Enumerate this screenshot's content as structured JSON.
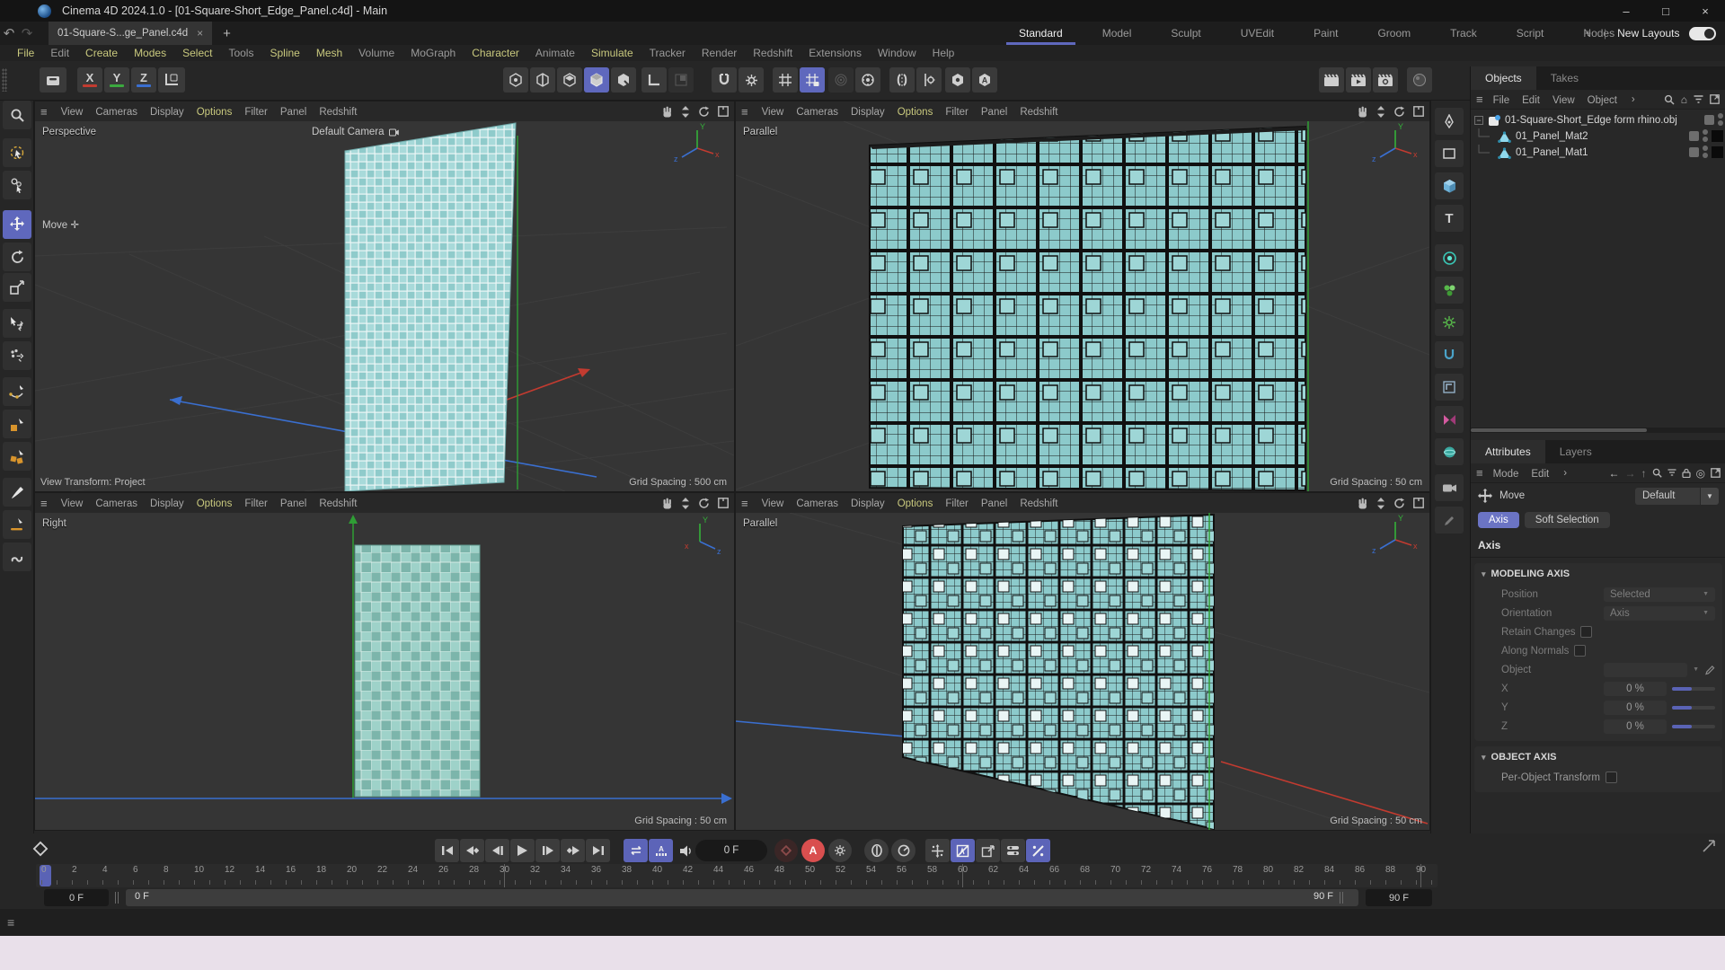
{
  "icons": {
    "hamburger": "≡",
    "close": "×",
    "plus": "+",
    "dropdown": "▼",
    "small_arrow": "▼",
    "collapse": "▾",
    "chevron": "›",
    "undo": "↶",
    "redo": "↷",
    "back": "←",
    "forward": "→",
    "up": "↑",
    "home": "⌂",
    "target": "◎",
    "minimize": "–",
    "maximize": "□",
    "expand_minus": "−",
    "move_cross": "✛"
  },
  "window": {
    "title": "Cinema 4D 2024.1.0 - [01-Square-Short_Edge_Panel.c4d] - Main"
  },
  "tab_bar": {
    "document_tab": "01-Square-S...ge_Panel.c4d"
  },
  "layout_tabs": {
    "items": [
      {
        "label": "Standard",
        "cls": "active"
      },
      {
        "label": "Model"
      },
      {
        "label": "Sculpt"
      },
      {
        "label": "UVEdit"
      },
      {
        "label": "Paint"
      },
      {
        "label": "Groom"
      },
      {
        "label": "Track"
      },
      {
        "label": "Script"
      },
      {
        "label": "Nodes"
      }
    ],
    "add": "+",
    "new_layouts_label": "New Layouts"
  },
  "menu_bar": {
    "items": [
      {
        "label": "File",
        "cls": "hl"
      },
      {
        "label": "Edit"
      },
      {
        "label": "Create",
        "cls": "hl"
      },
      {
        "label": "Modes",
        "cls": "hl"
      },
      {
        "label": "Select",
        "cls": "hl"
      },
      {
        "label": "Tools"
      },
      {
        "label": "Spline",
        "cls": "hl"
      },
      {
        "label": "Mesh",
        "cls": "hl"
      },
      {
        "label": "Volume"
      },
      {
        "label": "MoGraph"
      },
      {
        "label": "Character",
        "cls": "hl"
      },
      {
        "label": "Animate"
      },
      {
        "label": "Simulate",
        "cls": "hl"
      },
      {
        "label": "Tracker"
      },
      {
        "label": "Render"
      },
      {
        "label": "Redshift"
      },
      {
        "label": "Extensions"
      },
      {
        "label": "Window"
      },
      {
        "label": "Help"
      }
    ]
  },
  "toolbar": {
    "x": "X",
    "y": "Y",
    "z": "Z"
  },
  "viewports": [
    {
      "name": "Perspective",
      "camera_label": "Default Camera",
      "tool_label": "Move",
      "view_transform": "View Transform: Project",
      "grid_spacing": "Grid Spacing : 500 cm",
      "menu": [
        {
          "label": "View"
        },
        {
          "label": "Cameras"
        },
        {
          "label": "Display"
        },
        {
          "label": "Options",
          "cls": "hl"
        },
        {
          "label": "Filter"
        },
        {
          "label": "Panel"
        },
        {
          "label": "Redshift"
        }
      ]
    },
    {
      "name": "Parallel",
      "grid_spacing": "Grid Spacing : 50 cm",
      "menu": [
        {
          "label": "View"
        },
        {
          "label": "Cameras"
        },
        {
          "label": "Display"
        },
        {
          "label": "Options",
          "cls": "hl"
        },
        {
          "label": "Filter"
        },
        {
          "label": "Panel"
        },
        {
          "label": "Redshift"
        }
      ]
    },
    {
      "name": "Right",
      "grid_spacing": "Grid Spacing : 50 cm",
      "menu": [
        {
          "label": "View"
        },
        {
          "label": "Cameras"
        },
        {
          "label": "Display"
        },
        {
          "label": "Options",
          "cls": "hl"
        },
        {
          "label": "Filter"
        },
        {
          "label": "Panel"
        },
        {
          "label": "Redshift"
        }
      ]
    },
    {
      "name": "Parallel",
      "grid_spacing": "Grid Spacing : 50 cm",
      "menu": [
        {
          "label": "View"
        },
        {
          "label": "Cameras"
        },
        {
          "label": "Display"
        },
        {
          "label": "Options",
          "cls": "hl"
        },
        {
          "label": "Filter"
        },
        {
          "label": "Panel"
        },
        {
          "label": "Redshift"
        }
      ]
    }
  ],
  "objects_panel": {
    "tabs": [
      {
        "label": "Objects",
        "cls": "active"
      },
      {
        "label": "Takes"
      }
    ],
    "menu": [
      {
        "label": "File"
      },
      {
        "label": "Edit"
      },
      {
        "label": "View"
      },
      {
        "label": "Object"
      }
    ],
    "tree": [
      {
        "label": "01-Square-Short_Edge form rhino.obj"
      },
      {
        "label": "01_Panel_Mat2"
      },
      {
        "label": "01_Panel_Mat1"
      }
    ]
  },
  "attributes_panel": {
    "tabs": [
      {
        "label": "Attributes",
        "cls": "active"
      },
      {
        "label": "Layers"
      }
    ],
    "menu": [
      {
        "label": "Mode"
      },
      {
        "label": "Edit"
      }
    ],
    "tool": {
      "label": "Move",
      "preset": "Default"
    },
    "mode_buttons": [
      {
        "label": "Axis",
        "cls": "active"
      },
      {
        "label": "Soft Selection"
      }
    ],
    "heading": "Axis",
    "modeling_axis": {
      "title": "MODELING AXIS",
      "position_label": "Position",
      "position_value": "Selected",
      "orientation_label": "Orientation",
      "orientation_value": "Axis",
      "retain_label": "Retain Changes",
      "along_label": "Along Normals",
      "object_label": "Object",
      "x_label": "X",
      "x_value": "0 %",
      "y_label": "Y",
      "y_value": "0 %",
      "z_label": "Z",
      "z_value": "0 %"
    },
    "object_axis": {
      "title": "OBJECT AXIS",
      "per_object_label": "Per-Object Transform"
    }
  },
  "timeline": {
    "current_frame": "0 F",
    "ticks": [
      0,
      2,
      4,
      6,
      8,
      10,
      12,
      14,
      16,
      18,
      20,
      22,
      24,
      26,
      28,
      30,
      32,
      34,
      36,
      38,
      40,
      42,
      44,
      46,
      48,
      50,
      52,
      54,
      56,
      58,
      60,
      62,
      64,
      66,
      68,
      70,
      72,
      74,
      76,
      78,
      80,
      82,
      84,
      86,
      88,
      90
    ],
    "range_left": "0 F",
    "bar_start": "0 F",
    "bar_end": "90 F",
    "range_right": "90 F",
    "autokey_letter": "A"
  },
  "colors": {
    "accent_blue": "#5f68bd",
    "menu_highlight": "#c9c97e",
    "autokey_red": "#d94f4f",
    "panel_teal": "#8fcdcd",
    "axis_green": "#35b23a",
    "axis_red": "#c23b30",
    "axis_blue": "#3a6fd0",
    "bottom_strip": "#e9e0ea"
  }
}
